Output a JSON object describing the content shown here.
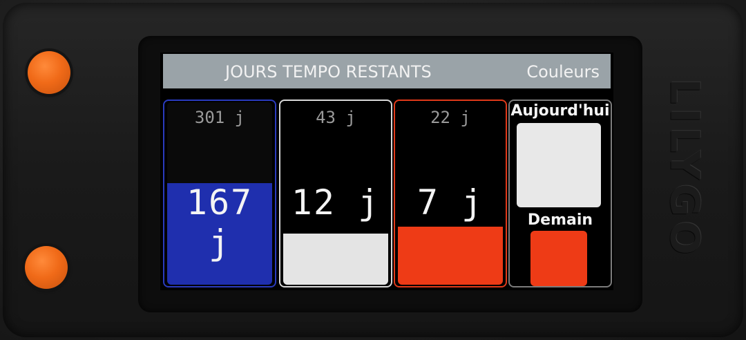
{
  "header": {
    "title": "JOURS TEMPO RESTANTS",
    "right": "Couleurs"
  },
  "columns": [
    {
      "total": "301 j",
      "remaining": "167 j",
      "fill_fraction": 0.555,
      "border_color": "#2a3bbf",
      "fill_color": "#1f2fae"
    },
    {
      "total": "43 j",
      "remaining": "12 j",
      "fill_fraction": 0.28,
      "border_color": "#d9d9d9",
      "fill_color": "#e4e4e4"
    },
    {
      "total": "22 j",
      "remaining": "7 j",
      "fill_fraction": 0.32,
      "border_color": "#e23a1a",
      "fill_color": "#ee3b16"
    }
  ],
  "today": {
    "label": "Aujourd'hui",
    "color": "#e8e8e8"
  },
  "tomorrow": {
    "label": "Demain",
    "color": "#ee3b16"
  },
  "device": {
    "brand": "LILYGO",
    "button_color": "#f06a18"
  }
}
